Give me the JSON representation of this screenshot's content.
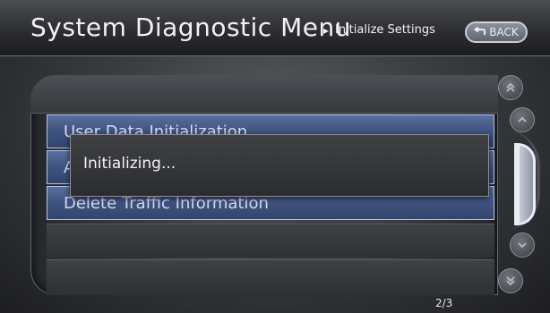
{
  "header": {
    "title": "System Diagnostic Menu",
    "breadcrumb_arrow": "▸",
    "subtitle": "Initialize Settings",
    "back_label": "BACK"
  },
  "menu": {
    "items": [
      {
        "label": "User Data Initialization"
      },
      {
        "label": "A"
      },
      {
        "label": "Delete Traffic Information"
      }
    ]
  },
  "dialog": {
    "message": "Initializing..."
  },
  "pagination": {
    "indicator": "2/3"
  },
  "icons": {
    "back": "return-arrow-icon",
    "scroll_page_up": "double-chevron-up-icon",
    "scroll_up": "chevron-up-icon",
    "scroll_down": "chevron-down-icon",
    "scroll_page_down": "double-chevron-down-icon"
  },
  "colors": {
    "highlight": "#3f5381",
    "header_bg": "#2d2e31",
    "text": "#f2f2f2"
  }
}
